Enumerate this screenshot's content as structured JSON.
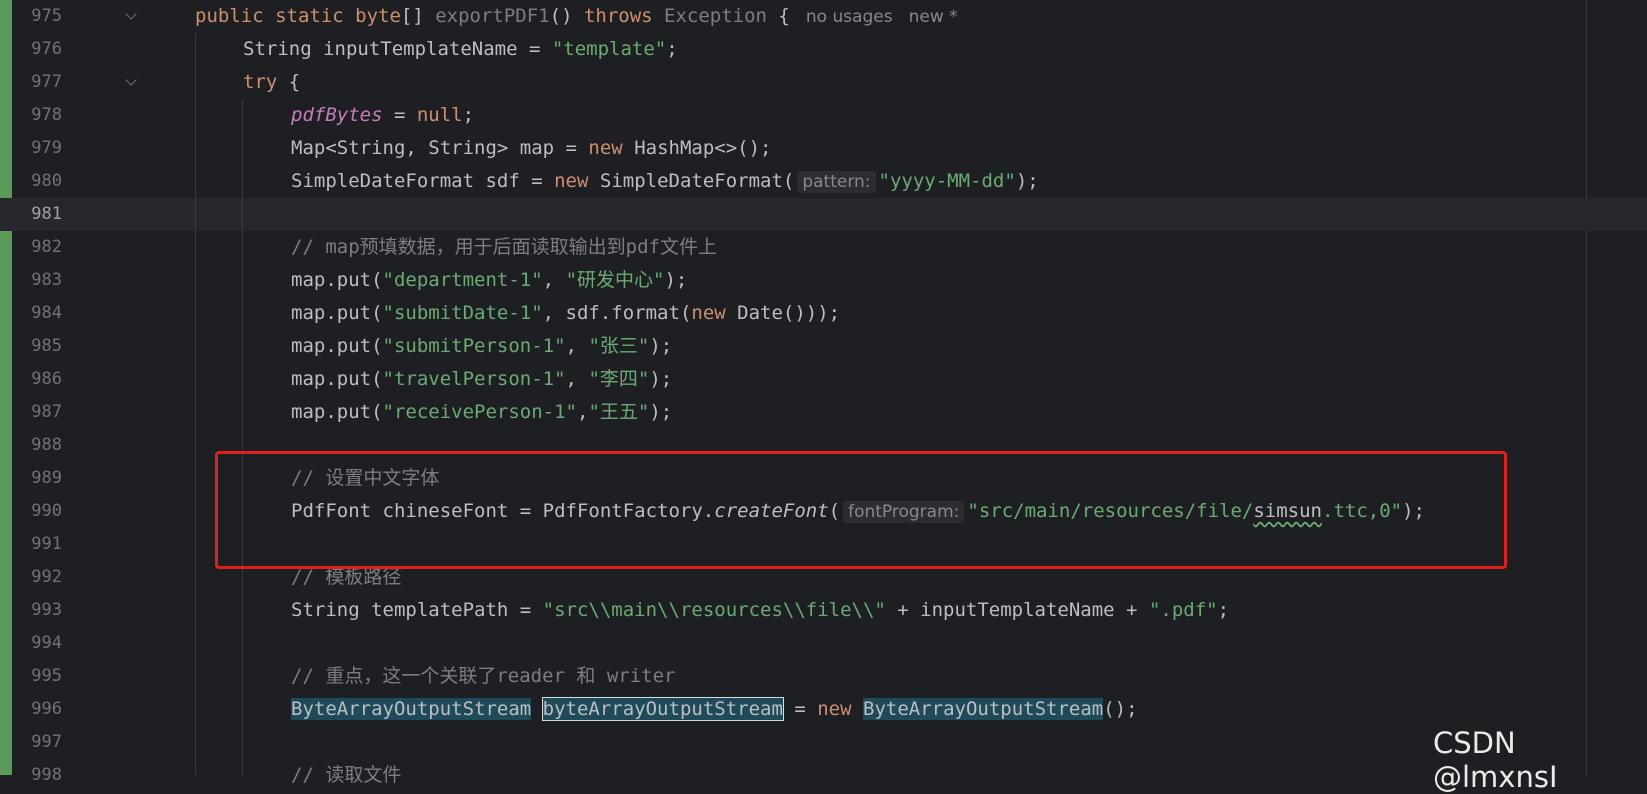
{
  "editor": {
    "lines": [
      {
        "n": "975",
        "fold": true,
        "indent": 1,
        "tokens": [
          [
            "kw",
            "public static byte"
          ],
          [
            "",
            "[] "
          ],
          [
            "dim",
            "exportPDF1"
          ],
          [
            "",
            "() "
          ],
          [
            "kw",
            "throws"
          ],
          [
            "",
            ""
          ],
          [
            "dim",
            " Exception"
          ],
          [
            "",
            " {"
          ],
          [
            "meta",
            "no usages"
          ],
          [
            "meta",
            "new *"
          ]
        ]
      },
      {
        "n": "976",
        "indent": 2,
        "tokens": [
          [
            "",
            "String inputTemplateName = "
          ],
          [
            "str",
            "\"template\""
          ],
          [
            "",
            ";"
          ]
        ]
      },
      {
        "n": "977",
        "fold": true,
        "indent": 2,
        "tokens": [
          [
            "kw",
            "try"
          ],
          [
            "",
            " {"
          ]
        ]
      },
      {
        "n": "978",
        "indent": 3,
        "tokens": [
          [
            "fld",
            "pdfBytes"
          ],
          [
            "",
            " = "
          ],
          [
            "kw",
            "null"
          ],
          [
            "",
            ";"
          ]
        ]
      },
      {
        "n": "979",
        "indent": 3,
        "tokens": [
          [
            "",
            "Map<String, String> map = "
          ],
          [
            "kw",
            "new"
          ],
          [
            "",
            " HashMap<>();"
          ]
        ]
      },
      {
        "n": "980",
        "indent": 3,
        "tokens": [
          [
            "",
            "SimpleDateFormat sdf = "
          ],
          [
            "kw",
            "new"
          ],
          [
            "",
            " SimpleDateFormat("
          ],
          [
            "hint",
            "pattern:"
          ],
          [
            "str",
            "\"yyyy-MM-dd\""
          ],
          [
            "",
            ");"
          ]
        ]
      },
      {
        "n": "981",
        "indent": 3,
        "current": true,
        "tokens": []
      },
      {
        "n": "982",
        "indent": 3,
        "tokens": [
          [
            "cmt",
            "// map预填数据，用于后面读取输出到pdf文件上"
          ]
        ]
      },
      {
        "n": "983",
        "indent": 3,
        "tokens": [
          [
            "",
            "map.put("
          ],
          [
            "str",
            "\"department-1\""
          ],
          [
            "",
            ", "
          ],
          [
            "str",
            "\"研发中心\""
          ],
          [
            "",
            ");"
          ]
        ]
      },
      {
        "n": "984",
        "indent": 3,
        "tokens": [
          [
            "",
            "map.put("
          ],
          [
            "str",
            "\"submitDate-1\""
          ],
          [
            "",
            ", sdf.format("
          ],
          [
            "kw",
            "new"
          ],
          [
            "",
            " Date()));"
          ]
        ]
      },
      {
        "n": "985",
        "indent": 3,
        "tokens": [
          [
            "",
            "map.put("
          ],
          [
            "str",
            "\"submitPerson-1\""
          ],
          [
            "",
            ", "
          ],
          [
            "str",
            "\"张三\""
          ],
          [
            "",
            ");"
          ]
        ]
      },
      {
        "n": "986",
        "indent": 3,
        "tokens": [
          [
            "",
            "map.put("
          ],
          [
            "str",
            "\"travelPerson-1\""
          ],
          [
            "",
            ", "
          ],
          [
            "str",
            "\"李四\""
          ],
          [
            "",
            ");"
          ]
        ]
      },
      {
        "n": "987",
        "indent": 3,
        "tokens": [
          [
            "",
            "map.put("
          ],
          [
            "str",
            "\"receivePerson-1\""
          ],
          [
            "",
            ","
          ],
          [
            "str",
            "\"王五\""
          ],
          [
            "",
            ");"
          ]
        ]
      },
      {
        "n": "988",
        "indent": 3,
        "tokens": []
      },
      {
        "n": "989",
        "indent": 3,
        "tokens": [
          [
            "cmt",
            "// 设置中文字体"
          ]
        ]
      },
      {
        "n": "990",
        "indent": 3,
        "tokens": [
          [
            "",
            "PdfFont chineseFont = PdfFontFactory."
          ],
          [
            "ital",
            "createFont"
          ],
          [
            "",
            "("
          ],
          [
            "hint",
            "fontProgram:"
          ],
          [
            "str",
            "\"src/main/resources/file/"
          ],
          [
            "squig",
            "simsun"
          ],
          [
            "str",
            ".ttc,0\""
          ],
          [
            "",
            ");"
          ]
        ]
      },
      {
        "n": "991",
        "indent": 3,
        "tokens": []
      },
      {
        "n": "992",
        "indent": 3,
        "tokens": [
          [
            "cmt",
            "// 模板路径"
          ]
        ]
      },
      {
        "n": "993",
        "indent": 3,
        "tokens": [
          [
            "",
            "String templatePath = "
          ],
          [
            "str",
            "\"src\\\\main\\\\resources\\\\file\\\\\""
          ],
          [
            "",
            " + inputTemplateName + "
          ],
          [
            "str",
            "\".pdf\""
          ],
          [
            "",
            ";"
          ]
        ]
      },
      {
        "n": "994",
        "indent": 3,
        "tokens": []
      },
      {
        "n": "995",
        "indent": 3,
        "tokens": [
          [
            "cmt",
            "// 重点，这一个关联了reader 和 writer"
          ]
        ]
      },
      {
        "n": "996",
        "indent": 3,
        "tokens": [
          [
            "usage",
            "ByteArrayOutputStream"
          ],
          [
            "",
            " "
          ],
          [
            "usage-sel",
            "byteArrayOutputStream"
          ],
          [
            "",
            " = "
          ],
          [
            "kw",
            "new"
          ],
          [
            "",
            " "
          ],
          [
            "usage",
            "ByteArrayOutputStream"
          ],
          [
            "",
            "();"
          ]
        ]
      },
      {
        "n": "997",
        "indent": 3,
        "tokens": []
      },
      {
        "n": "998",
        "indent": 3,
        "tokens": [
          [
            "cmt",
            "// 读取文件"
          ]
        ]
      }
    ]
  },
  "watermark": "CSDN @lmxnsI"
}
